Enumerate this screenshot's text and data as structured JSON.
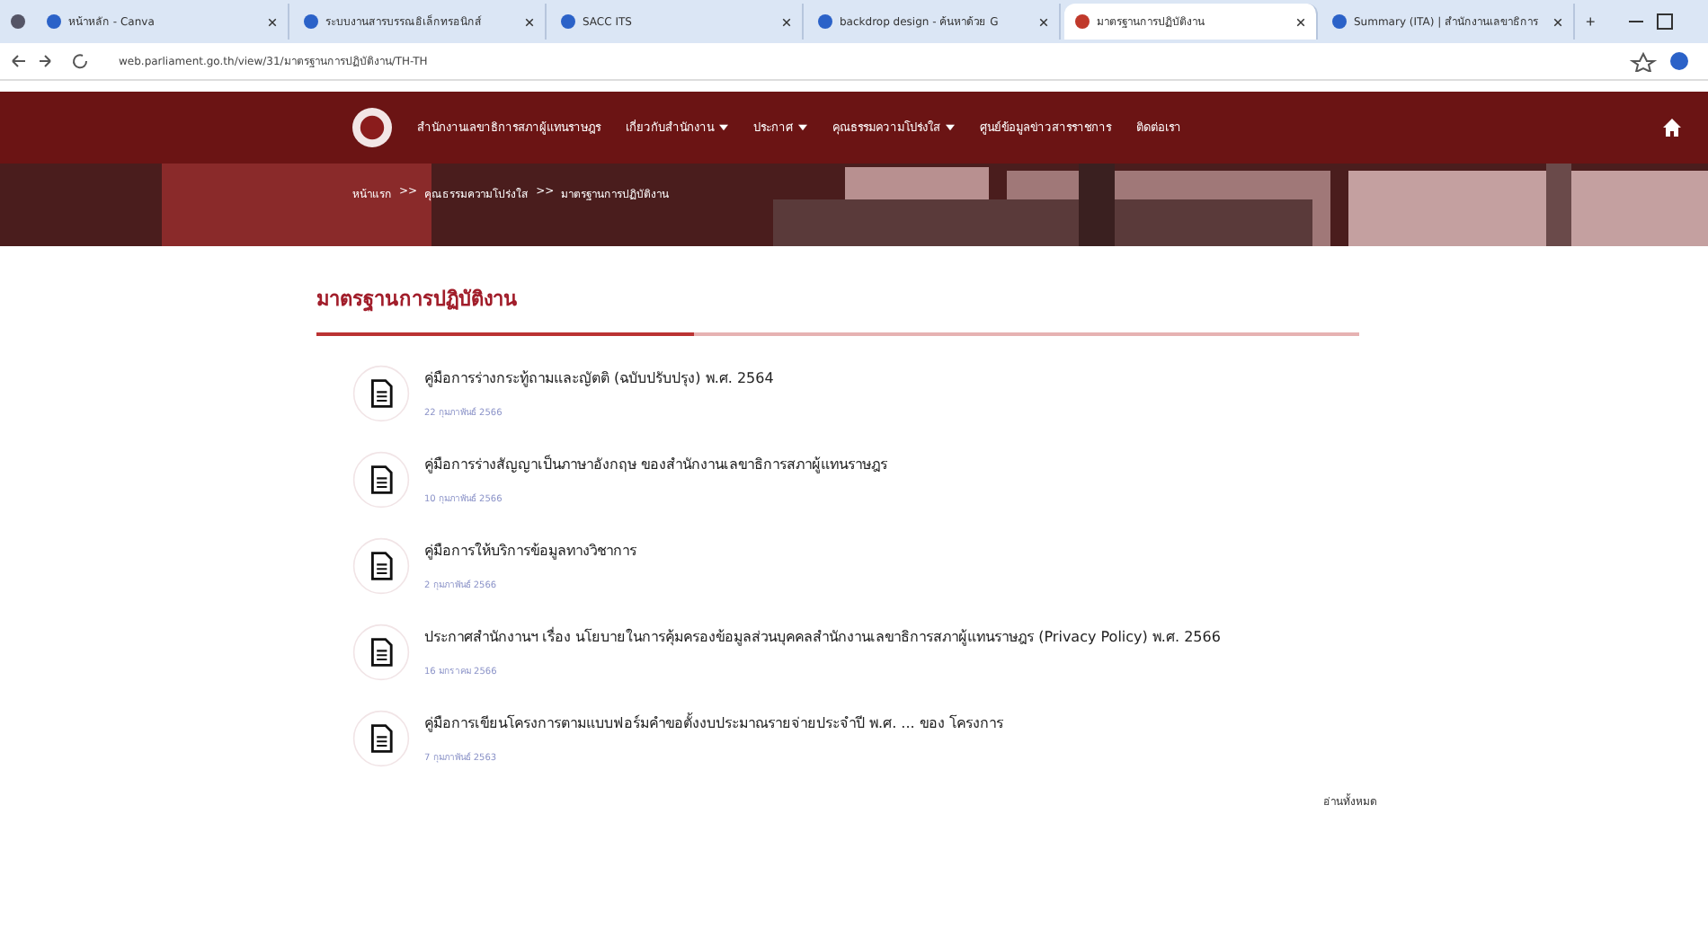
{
  "browser": {
    "tabs": [
      {
        "title": "หน้าหลัก - Canva",
        "selected": false
      },
      {
        "title": "ระบบงานสารบรรณอิเล็กทรอนิกส์",
        "selected": false
      },
      {
        "title": "SACC ITS",
        "selected": false
      },
      {
        "title": "backdrop design - ค้นหาด้วย G",
        "selected": false
      },
      {
        "title": "มาตรฐานการปฏิบัติงาน",
        "selected": true
      },
      {
        "title": "Summary (ITA) | สำนักงานเลขาธิการ",
        "selected": false
      }
    ],
    "new_tab": "+",
    "address": "web.parliament.go.th/view/31/มาตรฐานการปฏิบัติงาน/TH-TH"
  },
  "nav": {
    "items": [
      {
        "label": "สำนักงานเลขาธิการสภาผู้แทนราษฎร",
        "dropdown": false
      },
      {
        "label": "เกี่ยวกับสำนักงาน",
        "dropdown": true
      },
      {
        "label": "ประกาศ",
        "dropdown": true
      },
      {
        "label": "คุณธรรมความโปร่งใส",
        "dropdown": true
      },
      {
        "label": "ศูนย์ข้อมูลข่าวสารราชการ",
        "dropdown": false
      },
      {
        "label": "ติดต่อเรา",
        "dropdown": false
      }
    ]
  },
  "breadcrumb": [
    "หน้าแรก",
    "คุณธรรมความโปร่งใส",
    "มาตรฐานการปฏิบัติงาน"
  ],
  "breadcrumb_separator": ">>",
  "section_title": "มาตรฐานการปฏิบัติงาน",
  "documents": [
    {
      "title": "คู่มือการร่างกระทู้ถามและญัตติ (ฉบับปรับปรุง) พ.ศ. 2564",
      "date": "22 กุมภาพันธ์ 2566"
    },
    {
      "title": "คู่มือการร่างสัญญาเป็นภาษาอังกฤษ ของสำนักงานเลขาธิการสภาผู้แทนราษฎร",
      "date": "10 กุมภาพันธ์ 2566"
    },
    {
      "title": "คู่มือการให้บริการข้อมูลทางวิชาการ",
      "date": "2 กุมภาพันธ์ 2566"
    },
    {
      "title": "ประกาศสำนักงานฯ เรื่อง นโยบายในการคุ้มครองข้อมูลส่วนบุคคลสำนักงานเลขาธิการสภาผู้แทนราษฎร (Privacy Policy) พ.ศ. 2566",
      "date": "16 มกราคม 2566"
    },
    {
      "title": "คู่มือการเขียนโครงการตามแบบฟอร์มคำขอตั้งงบประมาณรายจ่ายประจำปี พ.ศ. ... ของ โครงการ",
      "date": "7 กุมภาพันธ์ 2563"
    }
  ],
  "read_all": "อ่านทั้งหมด"
}
